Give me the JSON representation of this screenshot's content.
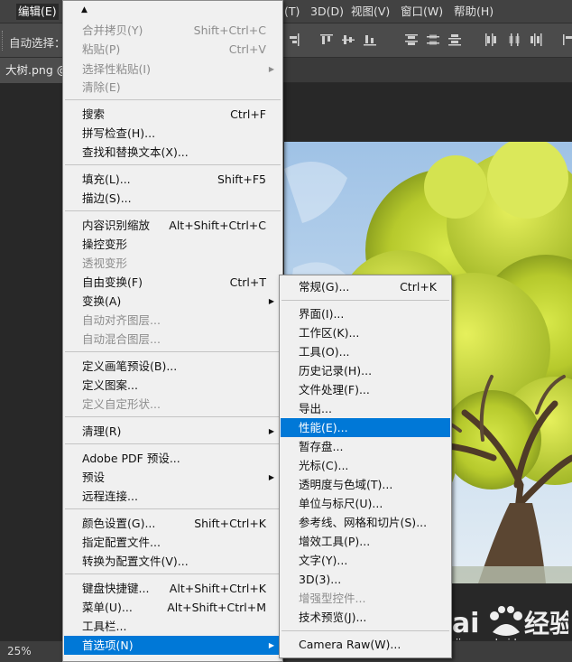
{
  "menubar": {
    "edit": "编辑(E)",
    "partial_right": "(T)",
    "threed": "3D(D)",
    "view": "视图(V)",
    "window": "窗口(W)",
    "help": "帮助(H)"
  },
  "optionsbar": {
    "auto_select": "自动选择："
  },
  "tabbar": {
    "doc_tab": "大树.png @"
  },
  "status": {
    "zoom": "25%"
  },
  "watermark": {
    "sub": "jingyan.baidu.com"
  },
  "edit_menu": {
    "merge_copy": {
      "label": "合并拷贝(Y)",
      "shortcut": "Shift+Ctrl+C"
    },
    "paste": {
      "label": "粘贴(P)",
      "shortcut": "Ctrl+V"
    },
    "paste_special": {
      "label": "选择性粘贴(I)"
    },
    "clear": {
      "label": "清除(E)"
    },
    "search": {
      "label": "搜索",
      "shortcut": "Ctrl+F"
    },
    "spell_check": {
      "label": "拼写检查(H)..."
    },
    "find_replace": {
      "label": "查找和替换文本(X)..."
    },
    "fill": {
      "label": "填充(L)...",
      "shortcut": "Shift+F5"
    },
    "stroke": {
      "label": "描边(S)..."
    },
    "content_aware_scale": {
      "label": "内容识别缩放",
      "shortcut": "Alt+Shift+Ctrl+C"
    },
    "puppet_warp": {
      "label": "操控变形"
    },
    "perspective_warp": {
      "label": "透视变形"
    },
    "free_transform": {
      "label": "自由变换(F)",
      "shortcut": "Ctrl+T"
    },
    "transform": {
      "label": "变换(A)"
    },
    "auto_align": {
      "label": "自动对齐图层..."
    },
    "auto_blend": {
      "label": "自动混合图层..."
    },
    "define_brush": {
      "label": "定义画笔预设(B)..."
    },
    "define_pattern": {
      "label": "定义图案..."
    },
    "define_shape": {
      "label": "定义自定形状..."
    },
    "purge": {
      "label": "清理(R)"
    },
    "pdf_presets": {
      "label": "Adobe PDF 预设..."
    },
    "presets": {
      "label": "预设"
    },
    "remote": {
      "label": "远程连接..."
    },
    "color_settings": {
      "label": "颜色设置(G)...",
      "shortcut": "Shift+Ctrl+K"
    },
    "assign_profile": {
      "label": "指定配置文件..."
    },
    "convert_profile": {
      "label": "转换为配置文件(V)..."
    },
    "keyboard_shortcuts": {
      "label": "键盘快捷键...",
      "shortcut": "Alt+Shift+Ctrl+K"
    },
    "menus": {
      "label": "菜单(U)...",
      "shortcut": "Alt+Shift+Ctrl+M"
    },
    "toolbar": {
      "label": "工具栏..."
    },
    "preferences": {
      "label": "首选项(N)"
    }
  },
  "pref_menu": {
    "general": {
      "label": "常规(G)...",
      "shortcut": "Ctrl+K"
    },
    "interface": {
      "label": "界面(I)..."
    },
    "workspace": {
      "label": "工作区(K)..."
    },
    "tools": {
      "label": "工具(O)..."
    },
    "history": {
      "label": "历史记录(H)..."
    },
    "file_handling": {
      "label": "文件处理(F)..."
    },
    "export": {
      "label": "导出..."
    },
    "performance": {
      "label": "性能(E)..."
    },
    "scratch": {
      "label": "暂存盘..."
    },
    "cursors": {
      "label": "光标(C)..."
    },
    "transparency": {
      "label": "透明度与色域(T)..."
    },
    "units": {
      "label": "单位与标尺(U)..."
    },
    "guides": {
      "label": "参考线、网格和切片(S)..."
    },
    "plugins": {
      "label": "增效工具(P)..."
    },
    "type": {
      "label": "文字(Y)..."
    },
    "threed": {
      "label": "3D(3)..."
    },
    "enhanced_controls": {
      "label": "增强型控件..."
    },
    "tech_preview": {
      "label": "技术预览(J)..."
    },
    "camera_raw": {
      "label": "Camera Raw(W)..."
    }
  }
}
